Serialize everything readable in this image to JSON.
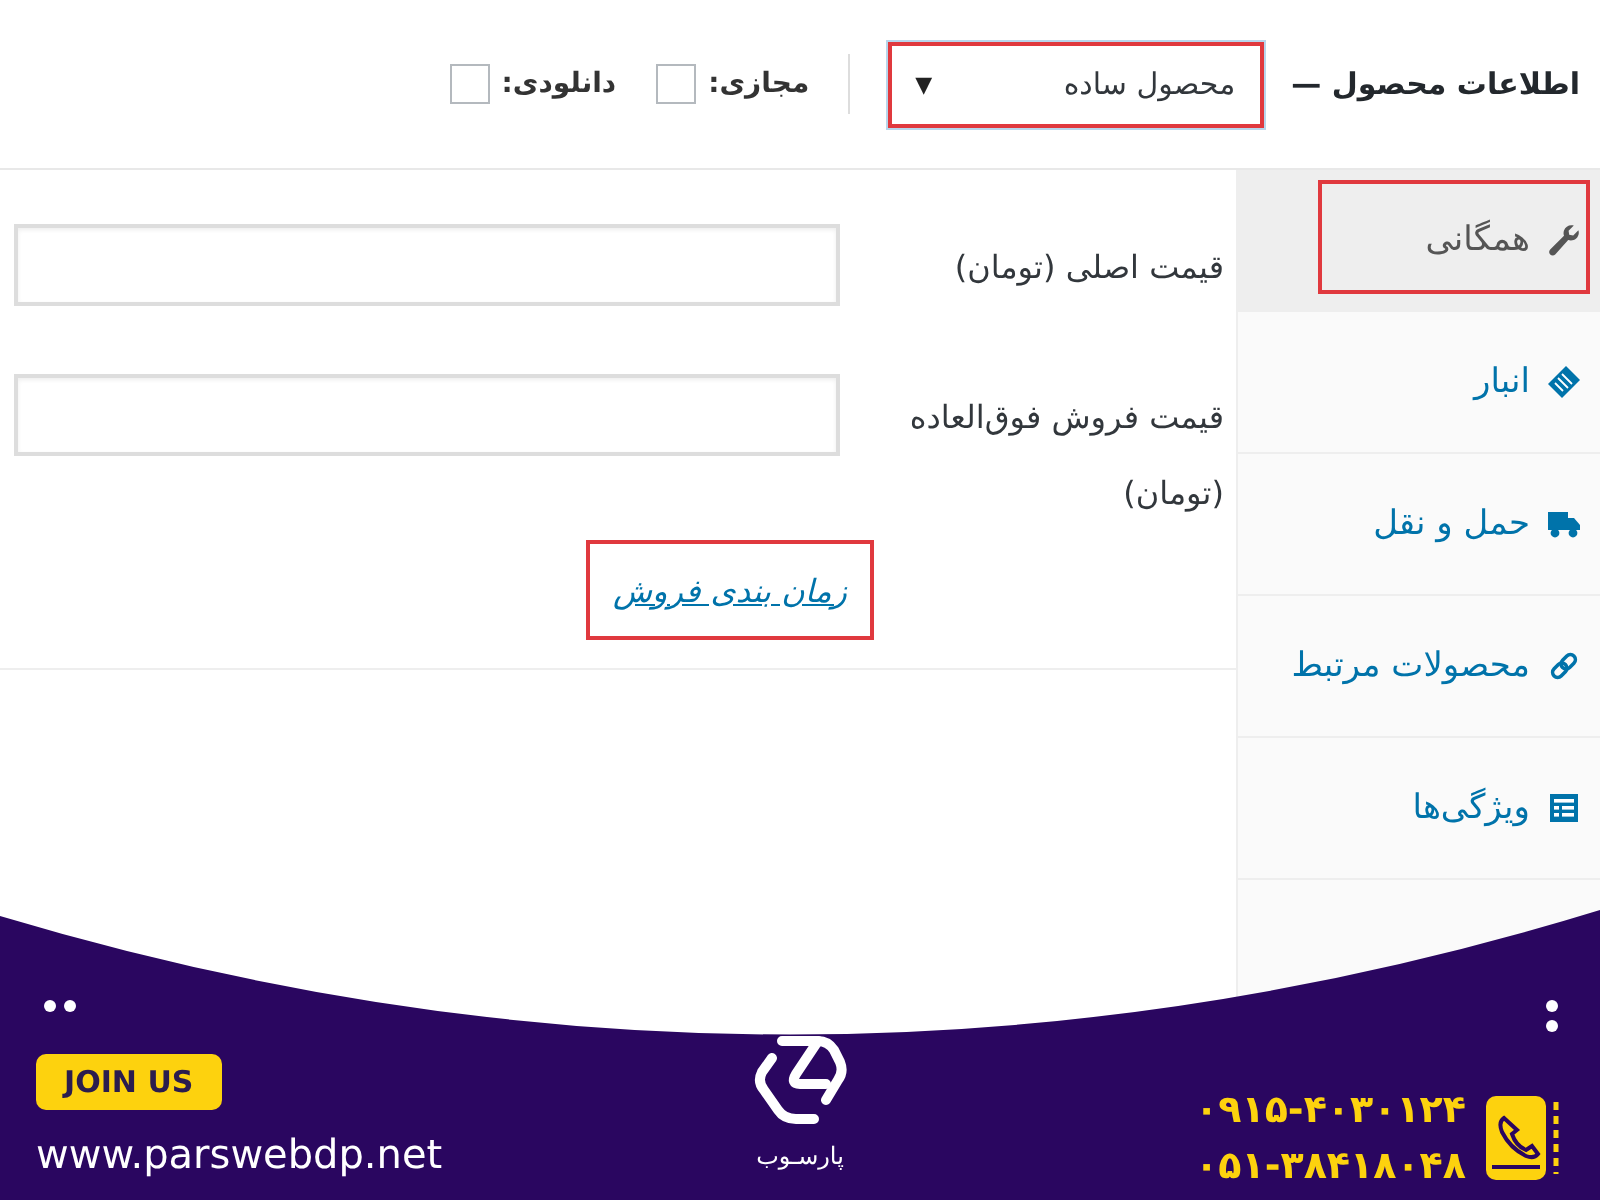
{
  "header": {
    "title": "اطلاعات محصول —",
    "product_type": {
      "value": "محصول ساده",
      "caret": "▼",
      "highlighted": true
    },
    "options": [
      {
        "label": "مجازی:",
        "checked": false
      },
      {
        "label": "دانلودی:",
        "checked": false
      }
    ]
  },
  "tabs": [
    {
      "kind": "general",
      "label": "همگانی",
      "selected": true,
      "highlighted": true
    },
    {
      "kind": "inventory",
      "label": "انبار",
      "selected": false,
      "highlighted": false
    },
    {
      "kind": "shipping",
      "label": "حمل و نقل",
      "selected": false,
      "highlighted": false
    },
    {
      "kind": "linked_products",
      "label": "محصولات مرتبط",
      "selected": false,
      "highlighted": false
    },
    {
      "kind": "attributes",
      "label": "ویژگی‌ها",
      "selected": false,
      "highlighted": false
    }
  ],
  "fields": [
    {
      "label": "قیمت اصلی (تومان)"
    },
    {
      "label": "قیمت فروش فوق‌العاده (تومان)"
    }
  ],
  "schedule_link": {
    "label": "زمان بندی فروش",
    "highlighted": true
  },
  "banner": {
    "button": "JOIN US",
    "website": "www.parswebdp.net",
    "logo_text": "پارسـوب",
    "phones": [
      "۰۹۱۵-۴۰۳۰۱۲۴",
      "۰۵۱-۳۸۴۱۸۰۴۸"
    ]
  }
}
